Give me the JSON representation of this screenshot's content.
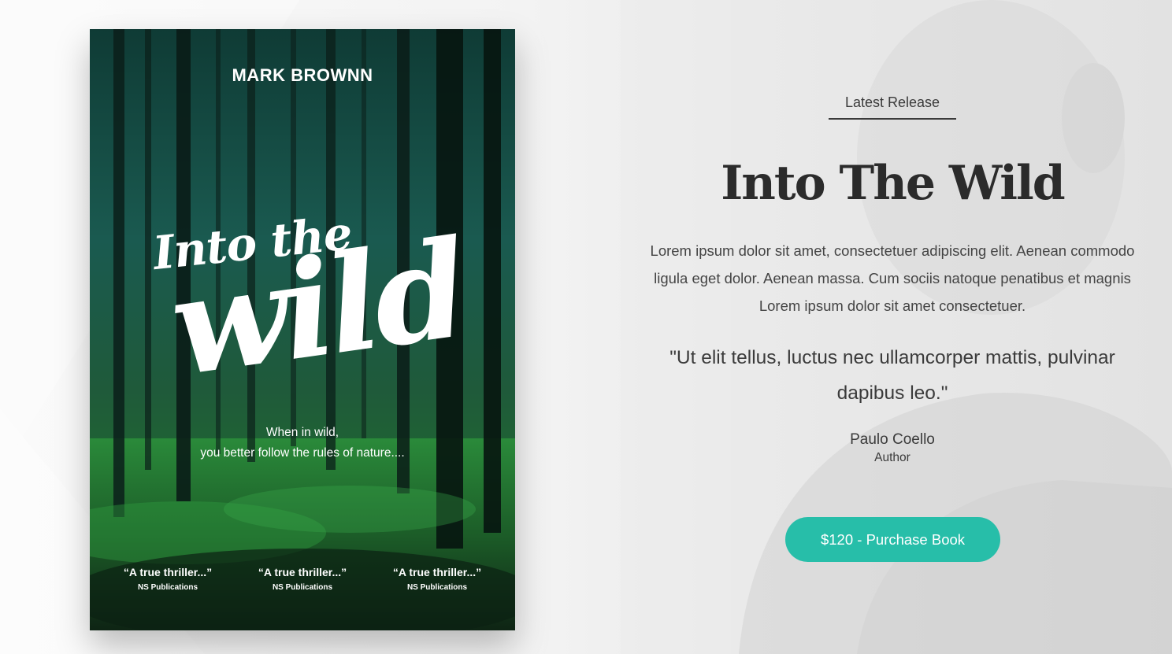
{
  "book_cover": {
    "author": "MARK BROWNN",
    "title_line1": "Into the",
    "title_line2": "wild",
    "tagline_line1": "When in wild,",
    "tagline_line2": "you better follow the rules of nature....",
    "reviews": [
      {
        "quote": "“A true thriller...”",
        "source": "NS Publications"
      },
      {
        "quote": "“A true thriller...”",
        "source": "NS Publications"
      },
      {
        "quote": "“A true thriller...”",
        "source": "NS Publications"
      }
    ]
  },
  "release": {
    "eyebrow": "Latest Release",
    "title": "Into The Wild",
    "description": "Lorem ipsum dolor sit amet, consectetuer adipiscing elit. Aenean commodo ligula eget dolor. Aenean massa. Cum sociis natoque penatibus et magnis Lorem ipsum dolor sit amet consectetuer.",
    "quote": "\"Ut elit tellus, luctus nec ullamcorper mattis, pulvinar dapibus leo.\"",
    "quote_author": "Paulo Coello",
    "quote_author_role": "Author",
    "purchase_button": "$120 - Purchase Book"
  },
  "colors": {
    "accent": "#27bea9",
    "heading": "#2b2b2b",
    "cover_dark": "#0d2e26"
  }
}
